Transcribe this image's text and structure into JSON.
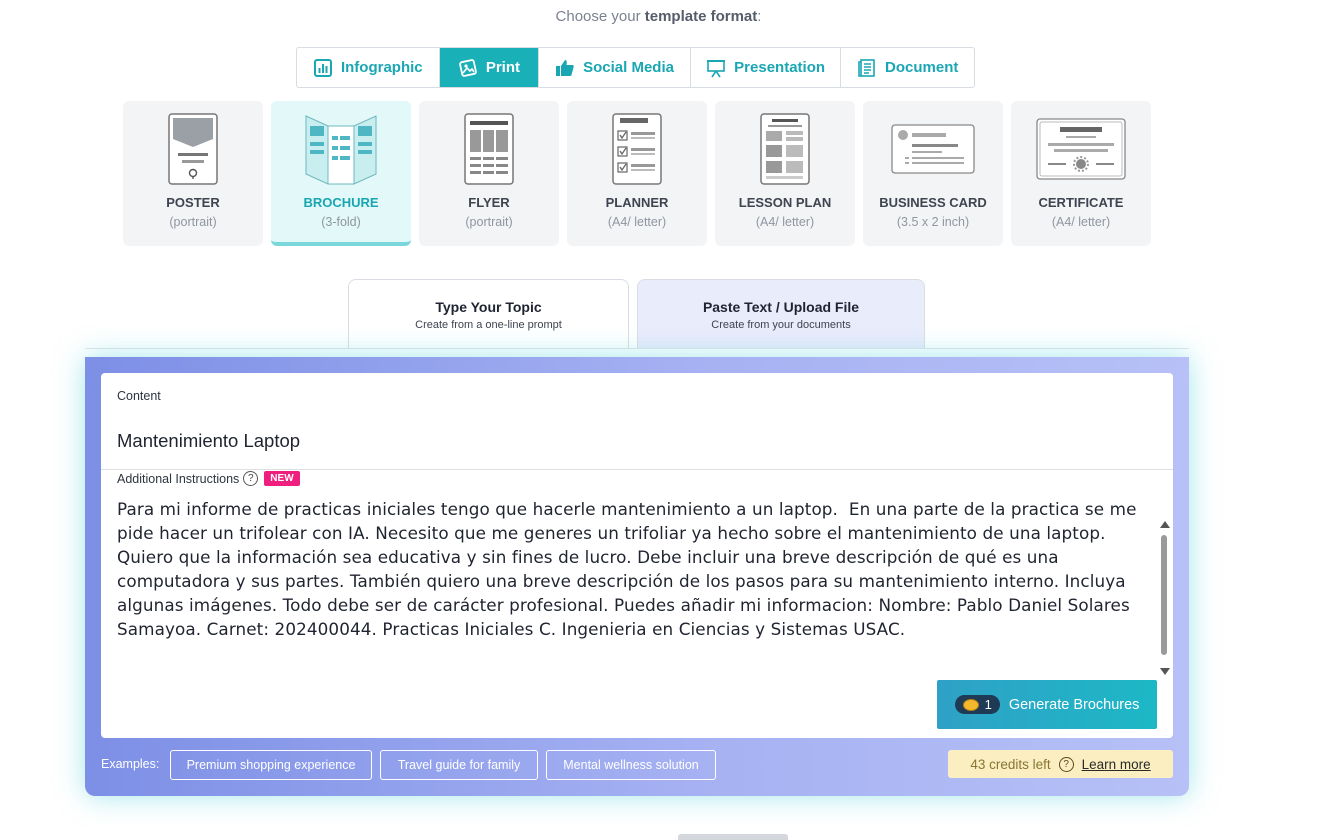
{
  "header": {
    "prefix": "Choose your ",
    "bold": "template format",
    "suffix": ":"
  },
  "format_tabs": [
    {
      "label": "Infographic",
      "icon": "bar-chart-icon",
      "active": false
    },
    {
      "label": "Print",
      "icon": "print-image-icon",
      "active": true
    },
    {
      "label": "Social Media",
      "icon": "thumbs-up-icon",
      "active": false
    },
    {
      "label": "Presentation",
      "icon": "presentation-board-icon",
      "active": false
    },
    {
      "label": "Document",
      "icon": "document-icon",
      "active": false
    }
  ],
  "templates": [
    {
      "name": "POSTER",
      "sub": "(portrait)"
    },
    {
      "name": "BROCHURE",
      "sub": "(3-fold)"
    },
    {
      "name": "FLYER",
      "sub": "(portrait)"
    },
    {
      "name": "PLANNER",
      "sub": "(A4/ letter)"
    },
    {
      "name": "LESSON PLAN",
      "sub": "(A4/ letter)"
    },
    {
      "name": "BUSINESS CARD",
      "sub": "(3.5 x 2 inch)"
    },
    {
      "name": "CERTIFICATE",
      "sub": "(A4/ letter)"
    }
  ],
  "mode_tabs": [
    {
      "title": "Type Your Topic",
      "subtitle": "Create from a one-line prompt"
    },
    {
      "title": "Paste Text / Upload File",
      "subtitle": "Create from your documents"
    }
  ],
  "form": {
    "content_label": "Content",
    "content_value": "Mantenimiento Laptop",
    "instructions_label": "Additional Instructions",
    "new_badge": "NEW",
    "instructions_value": "Para mi informe de practicas iniciales tengo que hacerle mantenimiento a un laptop.  En una parte de la practica se me pide hacer un trifolear con IA. Necesito que me generes un trifoliar ya hecho sobre el mantenimiento de una laptop.\nQuiero que la información sea educativa y sin fines de lucro. Debe incluir una breve descripción de qué es una computadora y sus partes. También quiero una breve descripción de los pasos para su mantenimiento interno. Incluya algunas imágenes. Todo debe ser de carácter profesional. Puedes añadir mi informacion: Nombre: Pablo Daniel Solares Samayoa. Carnet: 202400044. Practicas Iniciales C. Ingenieria en Ciencias y Sistemas USAC.",
    "generate_cost": "1",
    "generate_label": "Generate Brochures"
  },
  "examples": {
    "label": "Examples:",
    "chips": [
      "Premium shopping experience",
      "Travel guide for family",
      "Mental wellness solution"
    ]
  },
  "credits": {
    "text": "43 credits left",
    "link": "Learn more"
  },
  "colors": {
    "accent": "#1ab0b8",
    "badge": "#ee1f7f",
    "panel_start": "#7d8fe6",
    "panel_end": "#b7c1f7"
  }
}
